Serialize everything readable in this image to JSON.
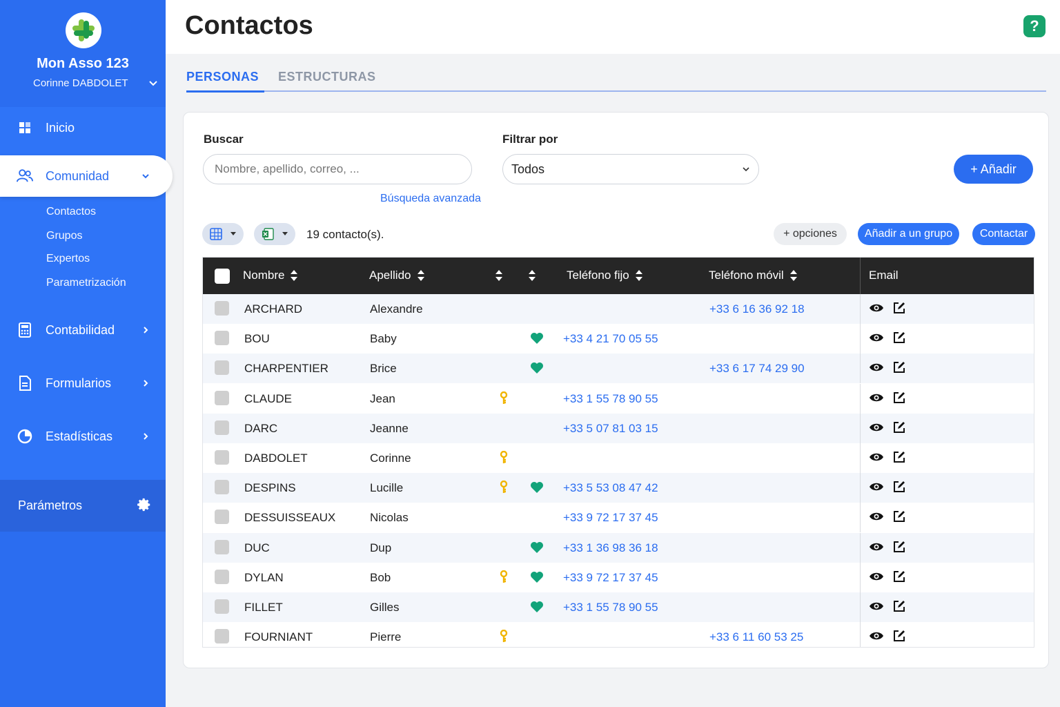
{
  "org": {
    "name": "Mon Asso 123",
    "user": "Corinne DABDOLET"
  },
  "nav": {
    "inicio": "Inicio",
    "comunidad": "Comunidad",
    "sub": [
      "Contactos",
      "Grupos",
      "Expertos",
      "Parametrización"
    ],
    "contabilidad": "Contabilidad",
    "formularios": "Formularios",
    "estadisticas": "Estadísticas",
    "parametros": "Parámetros"
  },
  "header": {
    "title": "Contactos",
    "help": "?"
  },
  "tabs": [
    "PERSONAS",
    "ESTRUCTURAS"
  ],
  "search": {
    "label": "Buscar",
    "placeholder": "Nombre, apellido, correo, ...",
    "advanced": "Búsqueda avanzada"
  },
  "filter": {
    "label": "Filtrar por",
    "value": "Todos"
  },
  "actions": {
    "add": "+ Añadir",
    "count": "19 contacto(s).",
    "options": "+  opciones",
    "add_group": "Añadir a un grupo",
    "contact": "Contactar"
  },
  "table": {
    "headers": {
      "nombre": "Nombre",
      "apellido": "Apellido",
      "fijo": "Teléfono fijo",
      "movil": "Teléfono móvil",
      "email": "Email"
    },
    "rows": [
      {
        "nombre": "ARCHARD",
        "apellido": "Alexandre",
        "fijo": "",
        "movil": "+33 6 16 36 92 18",
        "key": false,
        "heart": false
      },
      {
        "nombre": "BOU",
        "apellido": "Baby",
        "fijo": "+33 4 21 70 05 55",
        "movil": "",
        "key": false,
        "heart": true
      },
      {
        "nombre": "CHARPENTIER",
        "apellido": "Brice",
        "fijo": "",
        "movil": "+33 6 17 74 29 90",
        "key": false,
        "heart": true
      },
      {
        "nombre": "CLAUDE",
        "apellido": "Jean",
        "fijo": "+33 1 55 78 90 55",
        "movil": "",
        "key": true,
        "heart": false
      },
      {
        "nombre": "DARC",
        "apellido": "Jeanne",
        "fijo": "+33 5 07 81 03 15",
        "movil": "",
        "key": false,
        "heart": false
      },
      {
        "nombre": "DABDOLET",
        "apellido": "Corinne",
        "fijo": "",
        "movil": "",
        "key": true,
        "heart": false
      },
      {
        "nombre": "DESPINS",
        "apellido": "Lucille",
        "fijo": "+33 5 53 08 47 42",
        "movil": "",
        "key": true,
        "heart": true
      },
      {
        "nombre": "DESSUISSEAUX",
        "apellido": "Nicolas",
        "fijo": "+33 9 72 17 37 45",
        "movil": "",
        "key": false,
        "heart": false
      },
      {
        "nombre": "DUC",
        "apellido": "Dup",
        "fijo": "+33 1 36 98 36 18",
        "movil": "",
        "key": false,
        "heart": true
      },
      {
        "nombre": "DYLAN",
        "apellido": "Bob",
        "fijo": "+33 9 72 17 37 45",
        "movil": "",
        "key": true,
        "heart": true
      },
      {
        "nombre": "FILLET",
        "apellido": "Gilles",
        "fijo": "+33 1 55 78 90 55",
        "movil": "",
        "key": false,
        "heart": true
      },
      {
        "nombre": "FOURNIANT",
        "apellido": "Pierre",
        "fijo": "",
        "movil": "+33 6 11 60 53 25",
        "key": true,
        "heart": false
      }
    ]
  },
  "colors": {
    "primary": "#2b6df0",
    "sidebar": "#2f74f7",
    "header_dark": "#262626",
    "heart": "#12a37a",
    "key": "#f0b400",
    "help": "#18a36c"
  },
  "icons": {
    "key": "key-icon",
    "heart": "heart-icon",
    "view": "eye-icon",
    "edit": "edit-icon"
  }
}
